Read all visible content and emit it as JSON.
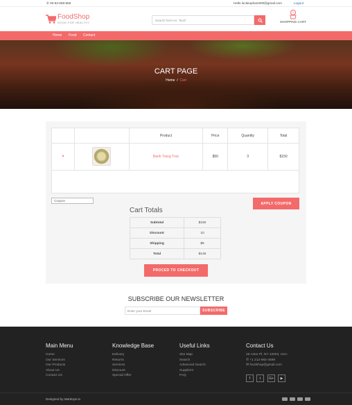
{
  "topbar": {
    "phone": "00-62-658-658",
    "greeting": "Hello luctieupham000@gmail.com",
    "logout": "Logout"
  },
  "brand": {
    "name": "FoodShop",
    "tagline": "GOOD FOR HEALTHY",
    "color": "#f36a6a"
  },
  "search": {
    "placeholder": "Search here ex: 'food'",
    "icon": "search-icon"
  },
  "cart": {
    "count": "1",
    "label": "SHOPPING CART",
    "icon": "basket-icon"
  },
  "nav": {
    "items": [
      "Home",
      "Food",
      "Contact"
    ]
  },
  "hero": {
    "title": "CART PAGE",
    "crumb_home": "Home",
    "crumb_sep": "/",
    "crumb_current": "Cart"
  },
  "cart_table": {
    "headers": [
      "",
      "",
      "Product",
      "Price",
      "Quantity",
      "Total"
    ],
    "rows": [
      {
        "remove": "×",
        "product": "Banh Trang Tron",
        "price": "$50",
        "quantity": "3",
        "total": "$150"
      }
    ]
  },
  "coupon": {
    "placeholder": "Coupon",
    "apply_label": "APPLY COUPON"
  },
  "totals": {
    "title": "Cart Totals",
    "rows": [
      {
        "label": "Subtotal",
        "value": "$150"
      },
      {
        "label": "Discount",
        "value": "10"
      },
      {
        "label": "Shipping",
        "value": "$5"
      },
      {
        "label": "Total",
        "value": "$145"
      }
    ],
    "checkout_label": "PROCED TO CHECKOUT"
  },
  "newsletter": {
    "title": "SUBSCRIBE OUR NEWSLETTER",
    "placeholder": "Enter your Email",
    "button": "SUBSCRIBE"
  },
  "footer": {
    "main_menu": {
      "title": "Main Menu",
      "items": [
        "Home",
        "Our Services",
        "Our Products",
        "About Us",
        "Contact Us"
      ]
    },
    "knowledge": {
      "title": "Knowledge Base",
      "items": [
        "Delivery",
        "Returns",
        "Services",
        "Discount",
        "Special Offer"
      ]
    },
    "links": {
      "title": "Useful Links",
      "items": [
        "Site Map",
        "Search",
        "Advanced Search",
        "Suppliers",
        "FAQ"
      ]
    },
    "contact": {
      "title": "Contact Us",
      "address": "25 Astor Pl, NY 10003, USA",
      "phone": "+1 212-982-4589",
      "email": "foodshop@gmail.com"
    },
    "social": [
      "f",
      "t",
      "G+",
      "yt"
    ],
    "designed_by": "Designed by MarkUps.io"
  }
}
